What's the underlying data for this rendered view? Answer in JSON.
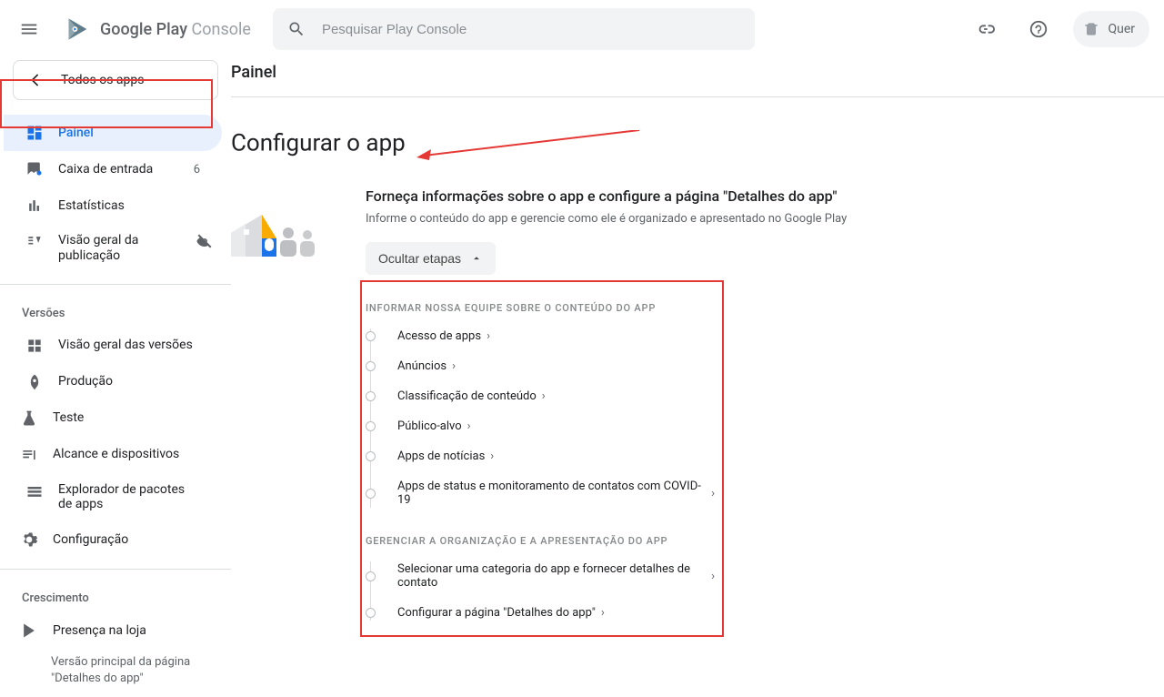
{
  "brand": {
    "name1": "Google Play",
    "name2": "Console"
  },
  "search": {
    "placeholder": "Pesquisar Play Console"
  },
  "top": {
    "accountChip": "Quer"
  },
  "allAppsBtn": "Todos os apps",
  "crumb": "Painel",
  "sidebar": {
    "group1": [
      {
        "name": "painel",
        "label": "Painel",
        "active": true
      },
      {
        "name": "inbox",
        "label": "Caixa de entrada",
        "badge": "6"
      },
      {
        "name": "stats",
        "label": "Estatísticas"
      },
      {
        "name": "puboverview",
        "label": "Visão geral da publicação",
        "muted": true
      }
    ],
    "versionsHeading": "Versões",
    "group2": [
      {
        "name": "releases-overview",
        "label": "Visão geral das versões"
      },
      {
        "name": "production",
        "label": "Produção"
      },
      {
        "name": "testing",
        "label": "Teste",
        "expand": true
      },
      {
        "name": "reach",
        "label": "Alcance e dispositivos",
        "expand": true
      },
      {
        "name": "bundleexplorer",
        "label": "Explorador de pacotes de apps"
      },
      {
        "name": "config",
        "label": "Configuração",
        "expand": true
      }
    ],
    "growthHeading": "Crescimento",
    "group3": [
      {
        "name": "storepresence",
        "label": "Presença na loja",
        "expand": true,
        "expanded": true
      }
    ],
    "subItems": [
      "Versão principal da página \"Detalhes do app\""
    ]
  },
  "main": {
    "pageTitle": "Configurar o app",
    "sectionTitle": "Forneça informações sobre o app e configure a página \"Detalhes do app\"",
    "sectionSub": "Informe o conteúdo do app e gerencie como ele é organizado e apresentado no Google Play",
    "collapseLabel": "Ocultar etapas",
    "taskGroup1": {
      "title": "INFORMAR NOSSA EQUIPE SOBRE O CONTEÚDO DO APP",
      "items": [
        "Acesso de apps",
        "Anúncios",
        "Classificação de conteúdo",
        "Público-alvo",
        "Apps de notícias",
        "Apps de status e monitoramento de contatos com COVID-19"
      ]
    },
    "taskGroup2": {
      "title": "GERENCIAR A ORGANIZAÇÃO E A APRESENTAÇÃO DO APP",
      "items": [
        "Selecionar uma categoria do app e fornecer detalhes de contato",
        "Configurar a página \"Detalhes do app\""
      ]
    }
  }
}
